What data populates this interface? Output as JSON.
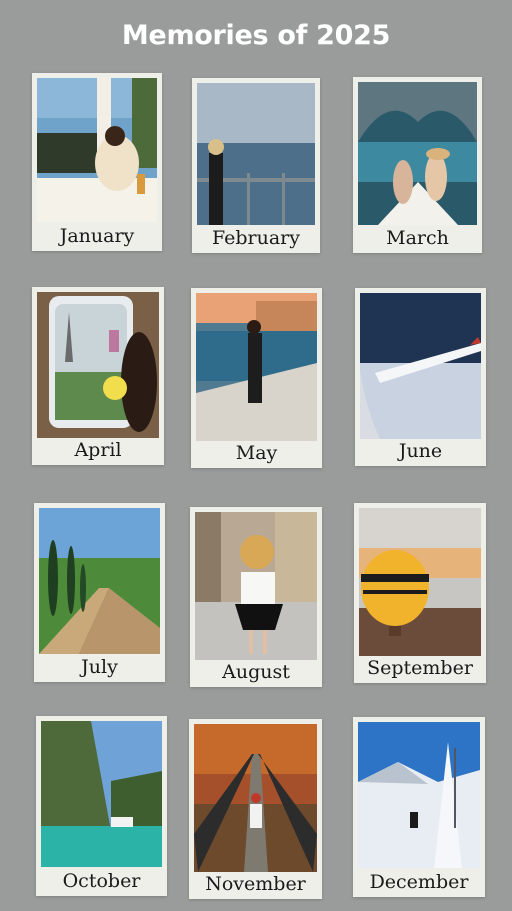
{
  "title": "Memories of 2025",
  "months": [
    {
      "label": "January"
    },
    {
      "label": "February"
    },
    {
      "label": "March"
    },
    {
      "label": "April"
    },
    {
      "label": "May"
    },
    {
      "label": "June"
    },
    {
      "label": "July"
    },
    {
      "label": "August"
    },
    {
      "label": "September"
    },
    {
      "label": "October"
    },
    {
      "label": "November"
    },
    {
      "label": "December"
    }
  ],
  "colors": {
    "background": "#9a9c9b",
    "card": "#eeefe9",
    "title": "#ffffff"
  }
}
